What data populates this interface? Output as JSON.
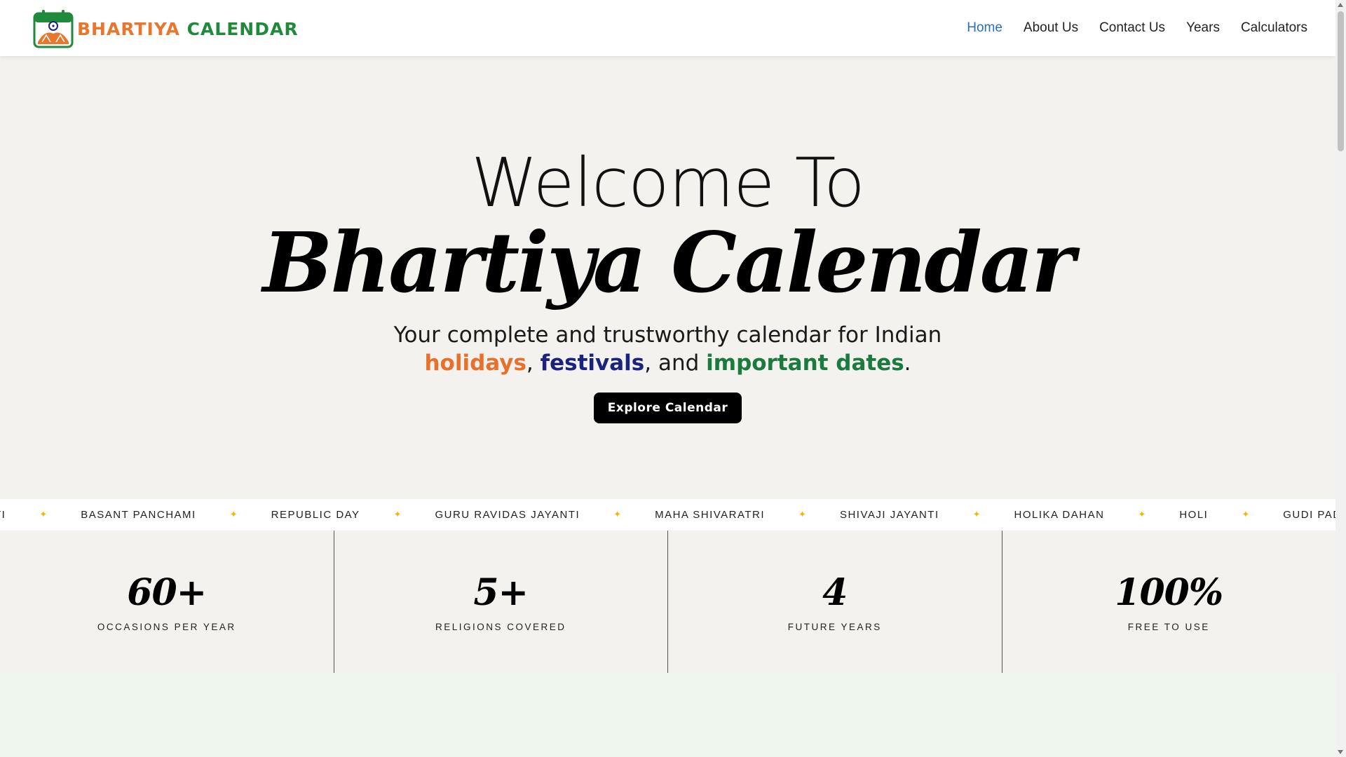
{
  "header": {
    "logo_word1": "BHARTIYA",
    "logo_word2": "CALENDAR",
    "nav": [
      {
        "label": "Home",
        "active": true
      },
      {
        "label": "About Us"
      },
      {
        "label": "Contact Us"
      },
      {
        "label": "Years"
      },
      {
        "label": "Calculators"
      }
    ]
  },
  "hero": {
    "welcome": "Welcome To",
    "brand": "Bhartiya Calendar",
    "tagline_line1": "Your complete and trustworthy calendar for Indian",
    "tagline_holidays": "holidays",
    "tagline_sep1": ",",
    "tagline_festivals": "festivals",
    "tagline_sep2": ", and",
    "tagline_important": "important dates",
    "tagline_end": ".",
    "cta_label": "Explore Calendar"
  },
  "ticker": {
    "items": [
      "TI",
      "BASANT PANCHAMI",
      "REPUBLIC DAY",
      "GURU RAVIDAS JAYANTI",
      "MAHA SHIVARATRI",
      "SHIVAJI JAYANTI",
      "HOLIKA DAHAN",
      "HOLI",
      "GUDI PADWA"
    ],
    "separator": "✦"
  },
  "stats": [
    {
      "value": "60+",
      "label": "OCCASIONS PER YEAR"
    },
    {
      "value": "5+",
      "label": "RELIGIONS COVERED"
    },
    {
      "value": "4",
      "label": "FUTURE YEARS"
    },
    {
      "value": "100%",
      "label": "FREE TO USE"
    }
  ],
  "colors": {
    "brand_orange": "#e8702a",
    "brand_green": "#1b7a3d",
    "brand_blue": "#1a237e",
    "nav_active": "#2a6fb5",
    "hero_bg": "#f3f2ef",
    "accent_star": "#f2b705"
  }
}
